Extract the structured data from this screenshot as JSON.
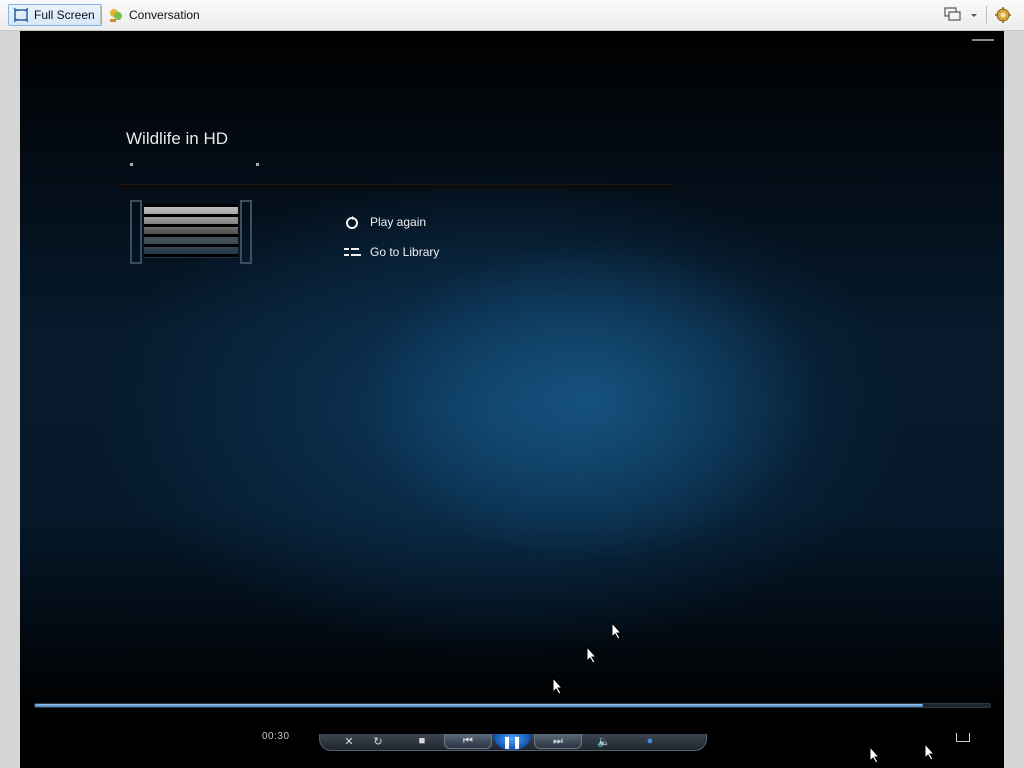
{
  "toolbar": {
    "full_screen_label": "Full Screen",
    "conversation_label": "Conversation"
  },
  "player": {
    "title": "Wildlife in HD",
    "actions": [
      {
        "label": "Play again",
        "icon": "replay-icon"
      },
      {
        "label": "Go to Library",
        "icon": "library-icon"
      }
    ],
    "elapsed": "00:30",
    "progress": 0.93
  },
  "colors": {
    "accent": "#3f7fbf",
    "play_button": "#1f6fd0",
    "background": "#061a2c"
  }
}
